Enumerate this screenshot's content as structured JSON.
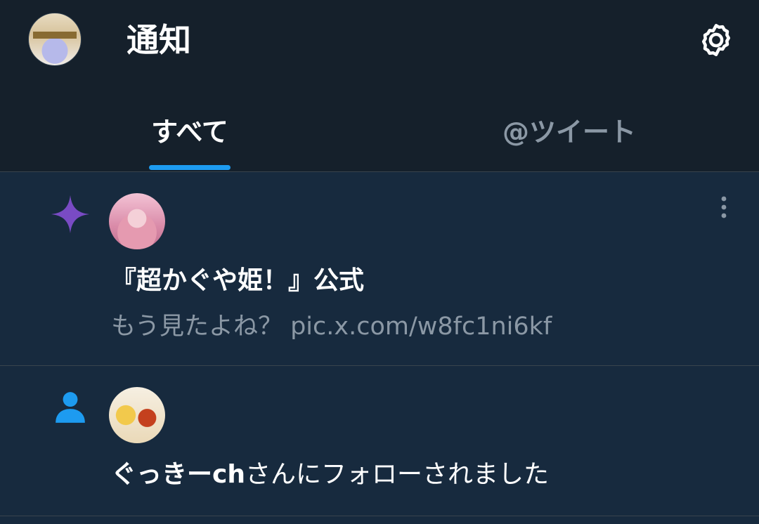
{
  "header": {
    "title": "通知"
  },
  "tabs": [
    {
      "label": "すべて",
      "active": true
    },
    {
      "label": "@ツイート",
      "active": false
    }
  ],
  "notifications": [
    {
      "type_icon": "sparkle-icon",
      "type_color": "#794bc4",
      "name": "『超かぐや姫！』公式",
      "text": "もう見たよね？ pic.x.com/w8fc1ni6kf"
    },
    {
      "type_icon": "person-icon",
      "type_color": "#1d9bf0",
      "name": "ぐっきーch",
      "text": "さんにフォローされました"
    }
  ],
  "colors": {
    "accent": "#1d9bf0",
    "header_bg": "#15202b",
    "row_bg": "#172a3e",
    "secondary_text": "#8b98a5"
  }
}
